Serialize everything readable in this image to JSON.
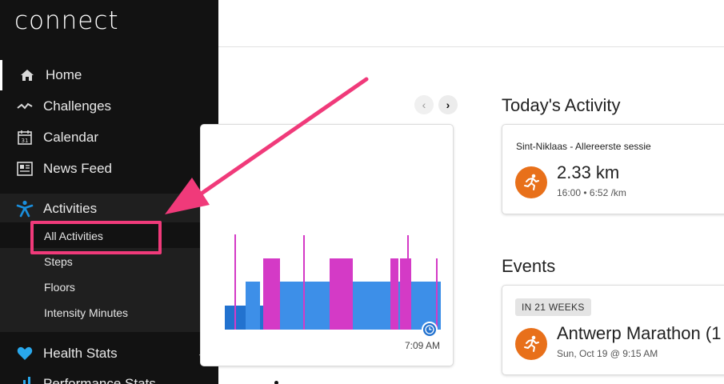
{
  "sidebar": {
    "logo": "connect",
    "items": [
      {
        "label": "Home",
        "icon": "home-icon"
      },
      {
        "label": "Challenges",
        "icon": "challenges-icon"
      },
      {
        "label": "Calendar",
        "icon": "calendar-icon",
        "icon_text": "31"
      },
      {
        "label": "News Feed",
        "icon": "news-feed-icon"
      },
      {
        "label": "Activities",
        "icon": "activities-icon"
      },
      {
        "label": "Health Stats",
        "icon": "heart-icon"
      },
      {
        "label": "Performance Stats",
        "icon": "performance-icon"
      }
    ],
    "activities_sub": [
      {
        "label": "All Activities"
      },
      {
        "label": "Steps"
      },
      {
        "label": "Floors"
      },
      {
        "label": "Intensity Minutes"
      }
    ]
  },
  "chart": {
    "time_label": "7:09 AM",
    "colors": {
      "light_blue": "#3d8fe8",
      "dark_blue": "#2272cf",
      "magenta": "#d43ac6"
    }
  },
  "todays_activity": {
    "title": "Today's Activity",
    "activity_name": "Sint-Niklaas - Allereerste sessie",
    "distance": "2.33 km",
    "details": "16:00 • 6:52 /km"
  },
  "events": {
    "title": "Events",
    "badge": "IN 21 WEEKS",
    "event_name": "Antwerp Marathon (1",
    "event_date": "Sun, Oct 19 @ 9:15 AM"
  },
  "colors": {
    "accent_orange": "#e8701a",
    "annotation": "#f03a7a",
    "garmin_blue": "#1a8fdd"
  }
}
